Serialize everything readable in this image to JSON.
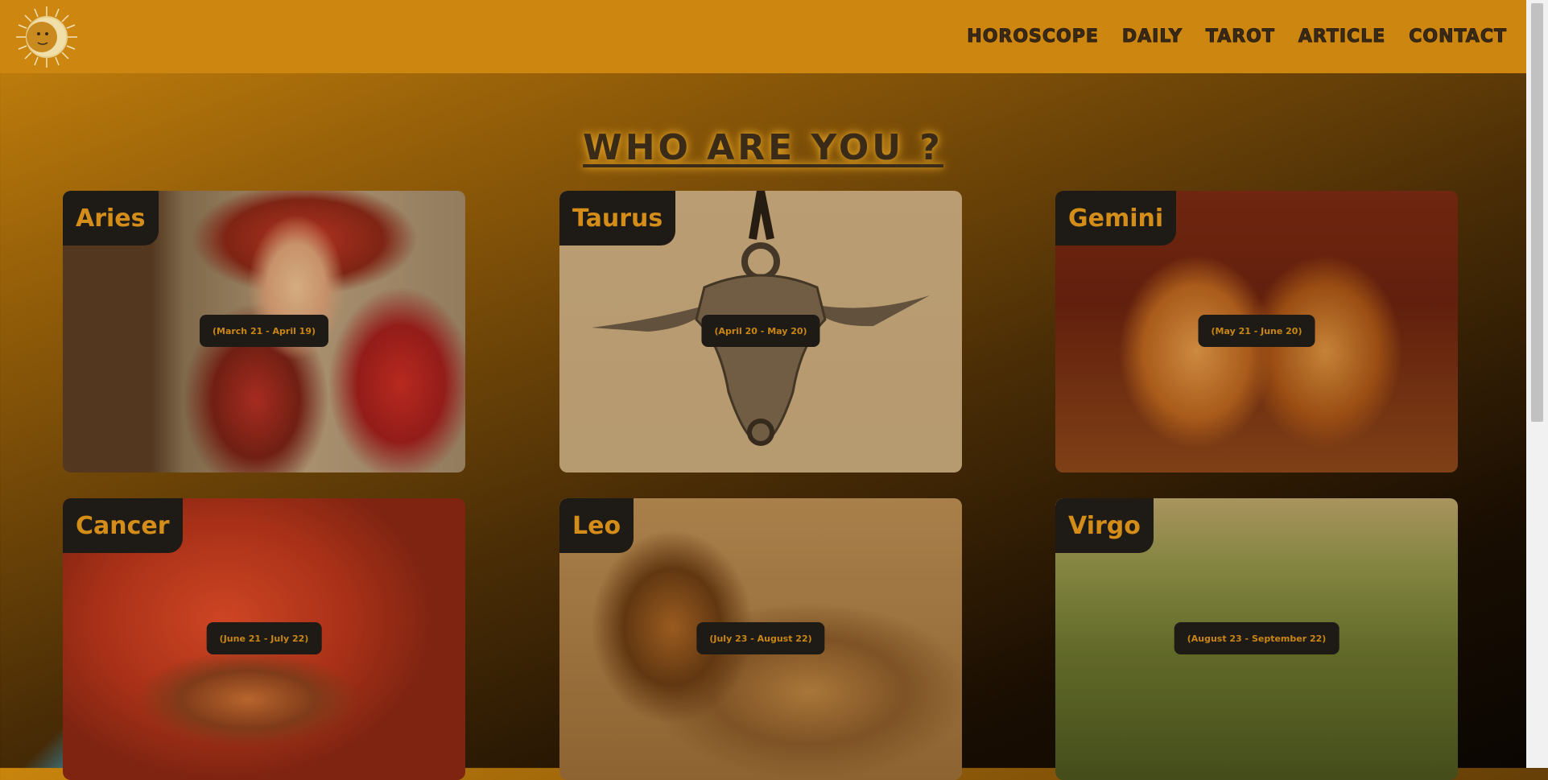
{
  "nav": {
    "items": [
      {
        "label": "HOROSCOPE"
      },
      {
        "label": "DAILY"
      },
      {
        "label": "TAROT"
      },
      {
        "label": "ARTICLE"
      },
      {
        "label": "CONTACT"
      }
    ]
  },
  "page": {
    "title": "WHO ARE YOU ?"
  },
  "signs": [
    {
      "name": "Aries",
      "dates": "(March 21 - April 19)"
    },
    {
      "name": "Taurus",
      "dates": "(April 20 - May 20)"
    },
    {
      "name": "Gemini",
      "dates": "(May 21 - June 20)"
    },
    {
      "name": "Cancer",
      "dates": "(June 21 - July 22)"
    },
    {
      "name": "Leo",
      "dates": "(July 23 - August 22)"
    },
    {
      "name": "Virgo",
      "dates": "(August 23 - September 22)"
    }
  ],
  "colors": {
    "header_bg": "#cd8710",
    "accent": "#d48d18",
    "label_bg": "#1e1b16"
  }
}
